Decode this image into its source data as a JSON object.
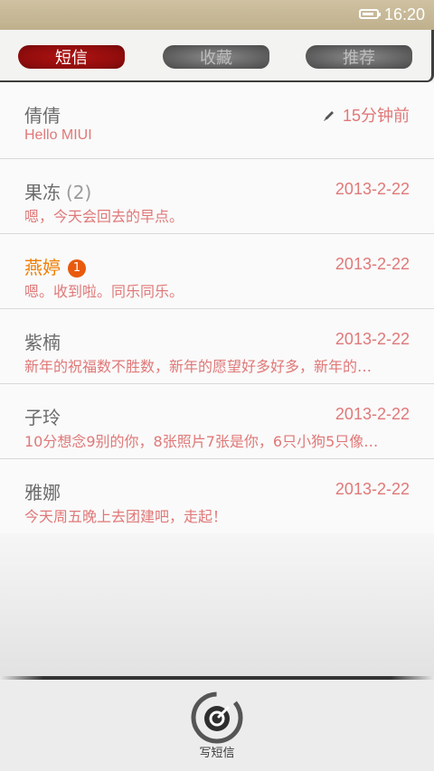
{
  "status_bar": {
    "time": "16:20",
    "battery_level": 0.85
  },
  "tabs": [
    {
      "label": "短信",
      "active": true
    },
    {
      "label": "收藏",
      "active": false
    },
    {
      "label": "推荐",
      "active": false
    }
  ],
  "conversations": [
    {
      "name": "倩倩",
      "count": "",
      "badge": "",
      "time": "15分钟前",
      "draft": true,
      "preview": "Hello MIUI"
    },
    {
      "name": "果冻",
      "count": "(2)",
      "badge": "",
      "time": "2013-2-22",
      "draft": false,
      "preview": "嗯，今天会回去的早点。"
    },
    {
      "name": "燕婷",
      "count": "",
      "badge": "1",
      "time": "2013-2-22",
      "draft": false,
      "preview": "嗯。收到啦。同乐同乐。"
    },
    {
      "name": "紫楠",
      "count": "",
      "badge": "",
      "time": "2013-2-22",
      "draft": false,
      "preview": "新年的祝福数不胜数，新年的愿望好多好多，新年的…"
    },
    {
      "name": "子玲",
      "count": "",
      "badge": "",
      "time": "2013-2-22",
      "draft": false,
      "preview": "10分想念9别的你，8张照片7张是你，6只小狗5只像…"
    },
    {
      "name": "雅娜",
      "count": "",
      "badge": "",
      "time": "2013-2-22",
      "draft": false,
      "preview": "今天周五晚上去团建吧，走起！"
    }
  ],
  "bottom": {
    "compose_label": "写短信"
  },
  "colors": {
    "accent": "#e07878",
    "unread_name": "#f07d00",
    "badge": "#e85a0e",
    "active_tab": "#9e0f0f"
  }
}
